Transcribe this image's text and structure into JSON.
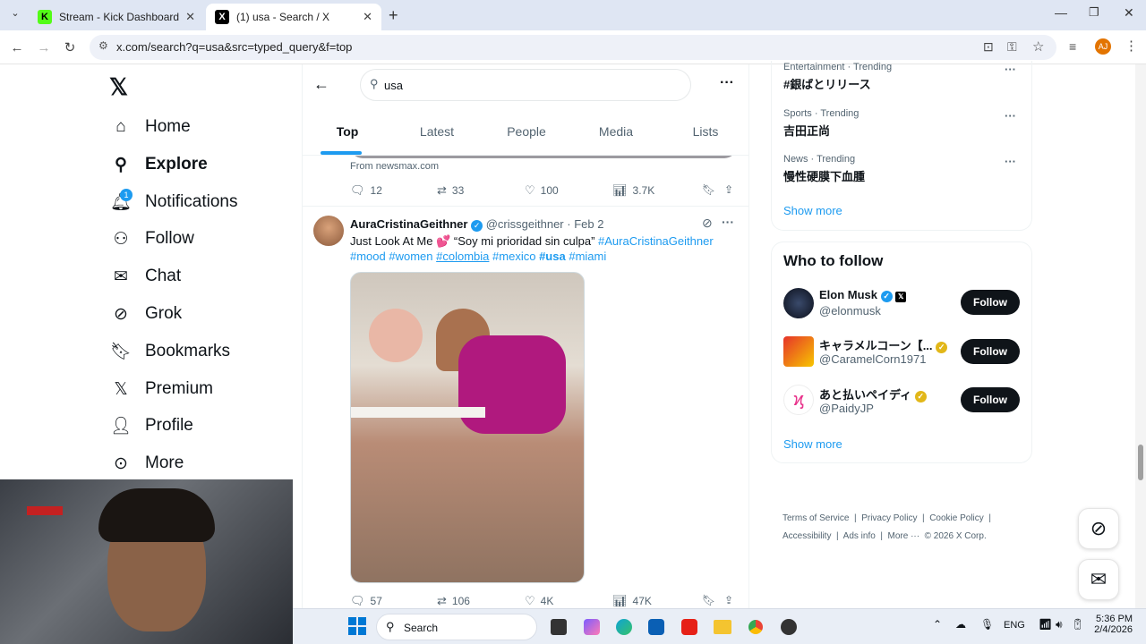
{
  "browser": {
    "tabs": [
      {
        "title": "Stream - Kick Dashboard"
      },
      {
        "title": "(1) usa - Search / X"
      }
    ],
    "url": "x.com/search?q=usa&src=typed_query&f=top",
    "avatar_letter": "AJ"
  },
  "nav": {
    "items": [
      "Home",
      "Explore",
      "Notifications",
      "Follow",
      "Chat",
      "Grok",
      "Bookmarks",
      "Premium",
      "Profile",
      "More"
    ],
    "notif_count": "1"
  },
  "search": {
    "query": "usa"
  },
  "tabs": [
    "Top",
    "Latest",
    "People",
    "Media",
    "Lists"
  ],
  "prev_post": {
    "source": "From newsmax.com",
    "replies": "12",
    "reposts": "33",
    "likes": "100",
    "views": "3.7K"
  },
  "post": {
    "name": "AuraCristinaGeithner",
    "handle": "@crissgeithner",
    "dot": "·",
    "date": "Feb 2",
    "text_start": "Just Look At Me 💕 “Soy mi prioridad sin culpa”",
    "tags_line1": "#AuraCristinaGeithner",
    "tags_line2": [
      "#mood",
      "#women",
      "#colombia",
      "#mexico",
      "#usa",
      "#miami"
    ],
    "replies": "57",
    "reposts": "106",
    "likes": "4K",
    "views": "47K"
  },
  "trends": [
    {
      "meta": "Entertainment · Trending",
      "name": "#銀ばとリリース"
    },
    {
      "meta": "Sports · Trending",
      "name": "吉田正尚"
    },
    {
      "meta": "News · Trending",
      "name": "慢性硬膜下血腫"
    }
  ],
  "show_more": "Show more",
  "who_to_follow": {
    "title": "Who to follow",
    "users": [
      {
        "name": "Elon Musk",
        "handle": "@elonmusk"
      },
      {
        "name": "キャラメルコーン【...",
        "handle": "@CaramelCorn1971"
      },
      {
        "name": "あと払いペイディ",
        "handle": "@PaidyJP"
      }
    ],
    "follow_label": "Follow",
    "show_more": "Show more"
  },
  "footer": {
    "links": [
      "Terms of Service",
      "|",
      "Privacy Policy",
      "|",
      "Cookie Policy",
      "|",
      "Accessibility",
      "|",
      "Ads info",
      "|",
      "More ···"
    ],
    "copyright": "© 2026 X Corp."
  },
  "taskbar": {
    "search": "Search",
    "lang": "ENG",
    "time": "5:36 PM",
    "date": "2/4/2026"
  },
  "colors": {
    "x_blue": "#1d9bf0",
    "text": "#0f1419",
    "muted": "#536471"
  }
}
